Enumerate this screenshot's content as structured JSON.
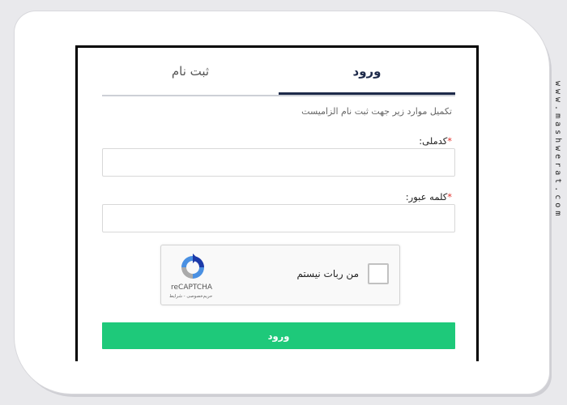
{
  "tabs": {
    "login": "ورود",
    "register": "ثبت نام"
  },
  "instruction": "تکمیل موارد زیر جهت ثبت نام الزامیست",
  "fields": {
    "national_code": {
      "label": "کدملی:",
      "value": ""
    },
    "password": {
      "label": "کلمه عبور:",
      "value": ""
    },
    "required_mark": "*"
  },
  "captcha": {
    "prompt": "من ربات نیستم",
    "brand": "reCAPTCHA",
    "terms": "حریم‌خصوصی - شرایط"
  },
  "submit_label": "ورود",
  "watermark": "www.mashwerat.com",
  "colors": {
    "accent_green": "#1ec97a",
    "tab_active": "#1e2a4a",
    "required": "#e3342f"
  }
}
